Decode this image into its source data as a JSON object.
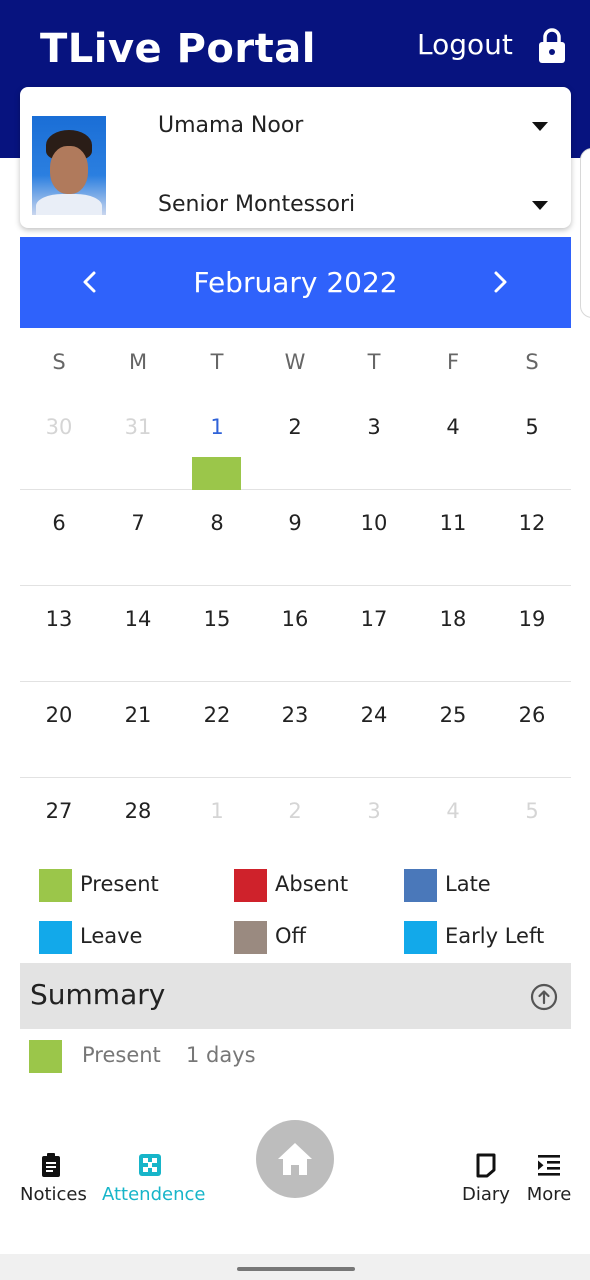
{
  "header": {
    "app_title": "TLive Portal",
    "logout_label": "Logout",
    "lock_icon": "lock-icon"
  },
  "student": {
    "name": "Umama Noor",
    "class_name": "Senior Montessori",
    "avatar": "student-photo"
  },
  "calendar": {
    "month_label": "February  2022",
    "weekdays": [
      "S",
      "M",
      "T",
      "W",
      "T",
      "F",
      "S"
    ],
    "weeks": [
      [
        "30",
        "31",
        "1",
        "2",
        "3",
        "4",
        "5"
      ],
      [
        "6",
        "7",
        "8",
        "9",
        "10",
        "11",
        "12"
      ],
      [
        "13",
        "14",
        "15",
        "16",
        "17",
        "18",
        "19"
      ],
      [
        "20",
        "21",
        "22",
        "23",
        "24",
        "25",
        "26"
      ],
      [
        "27",
        "28",
        "1",
        "2",
        "3",
        "4",
        "5"
      ]
    ],
    "today": "1",
    "present_marked_day": "1",
    "present_color": "#9bc64a"
  },
  "legend": [
    {
      "label": "Present",
      "color": "#9bc64a"
    },
    {
      "label": "Absent",
      "color": "#cf222b"
    },
    {
      "label": "Late",
      "color": "#4a78ba"
    },
    {
      "label": "Leave",
      "color": "#12a9ea"
    },
    {
      "label": "Off",
      "color": "#9a8a80"
    },
    {
      "label": "Early Left",
      "color": "#12a9ea"
    }
  ],
  "summary": {
    "title": "Summary",
    "toggle_icon": "arrow-up-circle-icon",
    "rows": [
      {
        "label": "Present",
        "value": "1 days",
        "color": "#9bc64a"
      }
    ]
  },
  "bottom_nav": {
    "items": [
      {
        "label": "Notices",
        "icon": "clipboard-icon"
      },
      {
        "label": "Attendence",
        "icon": "attendance-icon",
        "active": true
      },
      {
        "label": "Diary",
        "icon": "diary-icon"
      },
      {
        "label": "More",
        "icon": "menu-indent-icon"
      }
    ],
    "home_icon": "home-icon"
  },
  "colors": {
    "header_bg": "#07137f",
    "calendar_header_bg": "#2f62fb",
    "active_nav": "#17b5c9"
  }
}
